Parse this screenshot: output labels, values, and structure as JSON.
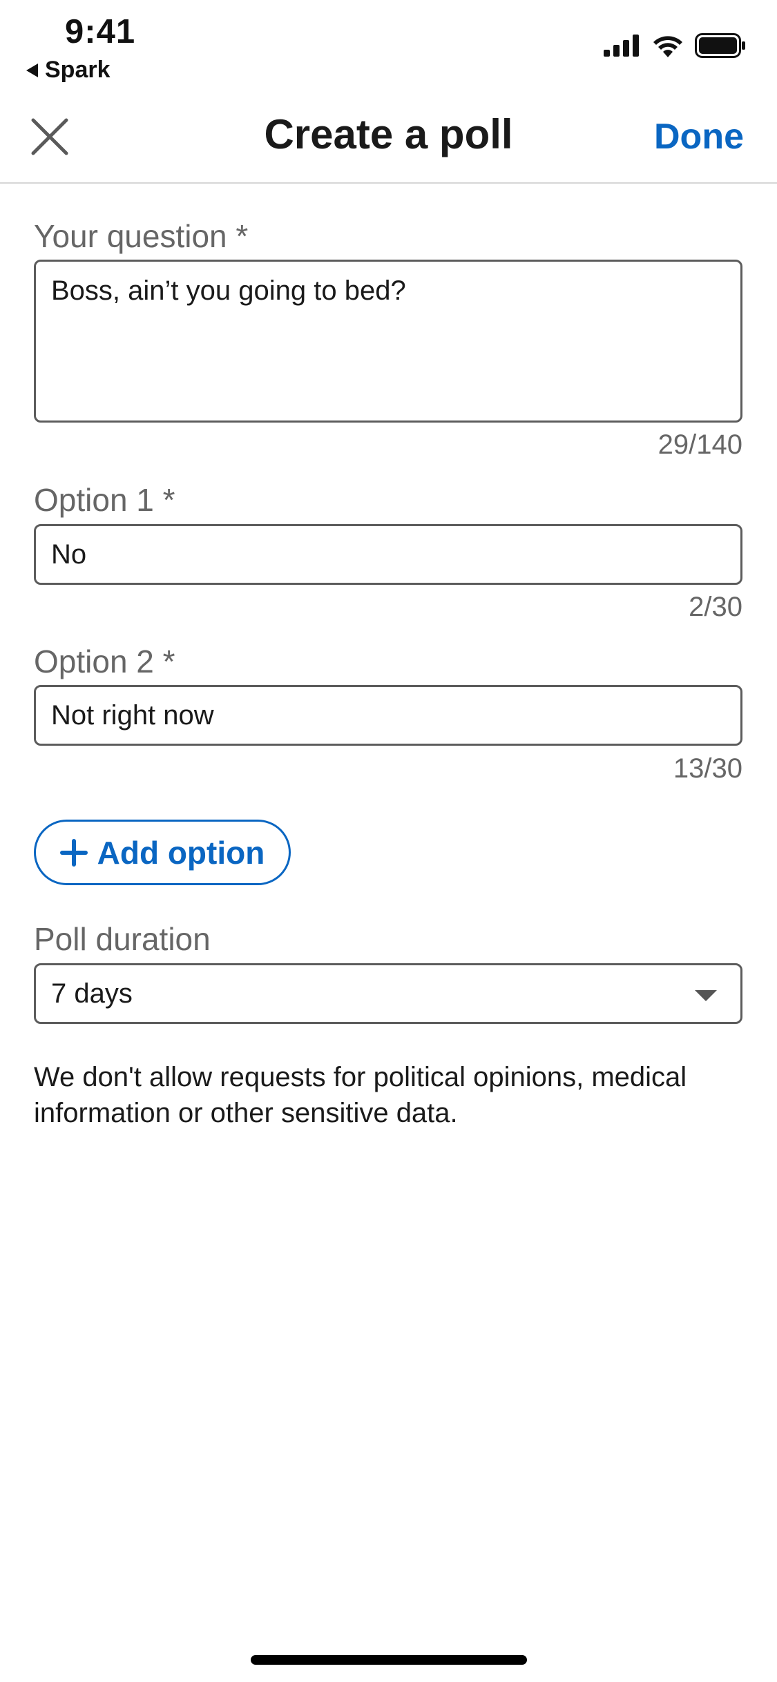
{
  "status_bar": {
    "time": "9:41",
    "back_app": "Spark",
    "icons": [
      "cellular-signal-icon",
      "wifi-icon",
      "battery-icon"
    ]
  },
  "nav": {
    "close_icon": "close-icon",
    "title": "Create a poll",
    "done_label": "Done"
  },
  "form": {
    "question": {
      "label": "Your question *",
      "value": "Boss, ain’t you going to bed?",
      "counter": "29/140"
    },
    "option1": {
      "label": "Option 1 *",
      "value": "No",
      "counter": "2/30"
    },
    "option2": {
      "label": "Option 2 *",
      "value": "Not right now",
      "counter": "13/30"
    },
    "add_option_label": "Add option",
    "duration": {
      "label": "Poll duration",
      "selected": "7 days"
    },
    "disclaimer": "We don't allow requests for political opinions, medical information or other sensitive data."
  },
  "colors": {
    "accent": "#0a66c2",
    "label_gray": "#666666",
    "text": "#1a1a1a"
  }
}
